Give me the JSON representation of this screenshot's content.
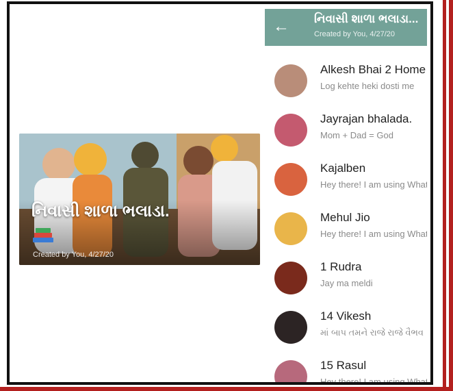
{
  "group_card": {
    "title": "નિવાસી શાળા ભલાડા.",
    "created": "Created by You, 4/27/20"
  },
  "header": {
    "back_icon": "back-arrow-icon",
    "title": "નિવાસી શાળા ભલાડા...",
    "subtitle": "Created by You, 4/27/20"
  },
  "contacts": [
    {
      "name": "Alkesh Bhai 2 Home",
      "status": "Log kehte heki dosti me",
      "avatar_color": "#b98d79"
    },
    {
      "name": "Jayrajan bhalada.",
      "status": "Mom + Dad = God",
      "avatar_color": "#c45a6f"
    },
    {
      "name": "Kajalben",
      "status": "Hey there! I am using WhatsApp.",
      "avatar_color": "#d9633f"
    },
    {
      "name": "Mehul Jio",
      "status": "Hey there! I am using WhatsApp.",
      "avatar_color": "#e9b54a"
    },
    {
      "name": "1 Rudra",
      "status": "Jay ma meldi",
      "avatar_color": "#7a2a1c"
    },
    {
      "name": "14 Vikesh",
      "status": "માં બાપ તમને રાજે રાજે વૈભવ",
      "avatar_color": "#2c2424"
    },
    {
      "name": "15 Rasul",
      "status": "Hey there! I am using WhatsApp.",
      "avatar_color": "#b7697c"
    }
  ],
  "colors": {
    "header_bg": "#73a298",
    "frame_border": "#111111",
    "accent_red": "#b3201f"
  }
}
